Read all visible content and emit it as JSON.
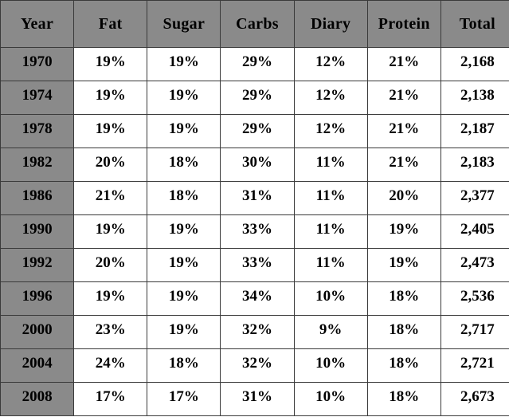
{
  "table": {
    "name": "nutrition-composition-by-year",
    "columns": [
      {
        "key": "year",
        "label": "Year",
        "shaded": true
      },
      {
        "key": "fat",
        "label": "Fat",
        "shaded": false
      },
      {
        "key": "sugar",
        "label": "Sugar",
        "shaded": false
      },
      {
        "key": "carbs",
        "label": "Carbs",
        "shaded": false
      },
      {
        "key": "diary",
        "label": "Diary",
        "shaded": false
      },
      {
        "key": "protein",
        "label": "Protein",
        "shaded": false
      },
      {
        "key": "total",
        "label": "Total",
        "shaded": false
      }
    ],
    "rows": [
      {
        "year": "1970",
        "fat": "19%",
        "sugar": "19%",
        "carbs": "29%",
        "diary": "12%",
        "protein": "21%",
        "total": "2,168"
      },
      {
        "year": "1974",
        "fat": "19%",
        "sugar": "19%",
        "carbs": "29%",
        "diary": "12%",
        "protein": "21%",
        "total": "2,138"
      },
      {
        "year": "1978",
        "fat": "19%",
        "sugar": "19%",
        "carbs": "29%",
        "diary": "12%",
        "protein": "21%",
        "total": "2,187"
      },
      {
        "year": "1982",
        "fat": "20%",
        "sugar": "18%",
        "carbs": "30%",
        "diary": "11%",
        "protein": "21%",
        "total": "2,183"
      },
      {
        "year": "1986",
        "fat": "21%",
        "sugar": "18%",
        "carbs": "31%",
        "diary": "11%",
        "protein": "20%",
        "total": "2,377"
      },
      {
        "year": "1990",
        "fat": "19%",
        "sugar": "19%",
        "carbs": "33%",
        "diary": "11%",
        "protein": "19%",
        "total": "2,405"
      },
      {
        "year": "1992",
        "fat": "20%",
        "sugar": "19%",
        "carbs": "33%",
        "diary": "11%",
        "protein": "19%",
        "total": "2,473"
      },
      {
        "year": "1996",
        "fat": "19%",
        "sugar": "19%",
        "carbs": "34%",
        "diary": "10%",
        "protein": "18%",
        "total": "2,536"
      },
      {
        "year": "2000",
        "fat": "23%",
        "sugar": "19%",
        "carbs": "32%",
        "diary": "9%",
        "protein": "18%",
        "total": "2,717"
      },
      {
        "year": "2004",
        "fat": "24%",
        "sugar": "18%",
        "carbs": "32%",
        "diary": "10%",
        "protein": "18%",
        "total": "2,721"
      },
      {
        "year": "2008",
        "fat": "17%",
        "sugar": "17%",
        "carbs": "31%",
        "diary": "10%",
        "protein": "18%",
        "total": "2,673"
      }
    ]
  },
  "chart_data": {
    "type": "table",
    "title": "",
    "columns": [
      "Year",
      "Fat",
      "Sugar",
      "Carbs",
      "Diary",
      "Protein",
      "Total"
    ],
    "x": [
      "1970",
      "1974",
      "1978",
      "1982",
      "1986",
      "1990",
      "1992",
      "1996",
      "2000",
      "2004",
      "2008"
    ],
    "xlabel": "Year",
    "ylabel": "",
    "series": [
      {
        "name": "Fat",
        "unit": "%",
        "values": [
          19,
          19,
          19,
          20,
          21,
          19,
          20,
          19,
          23,
          24,
          17
        ]
      },
      {
        "name": "Sugar",
        "unit": "%",
        "values": [
          19,
          19,
          19,
          18,
          18,
          19,
          19,
          19,
          19,
          18,
          17
        ]
      },
      {
        "name": "Carbs",
        "unit": "%",
        "values": [
          29,
          29,
          29,
          30,
          31,
          33,
          33,
          34,
          32,
          32,
          31
        ]
      },
      {
        "name": "Diary",
        "unit": "%",
        "values": [
          12,
          12,
          12,
          11,
          11,
          11,
          11,
          10,
          9,
          10,
          10
        ]
      },
      {
        "name": "Protein",
        "unit": "%",
        "values": [
          21,
          21,
          21,
          21,
          20,
          19,
          19,
          18,
          18,
          18,
          18
        ]
      },
      {
        "name": "Total",
        "unit": "calories",
        "values": [
          2168,
          2138,
          2187,
          2183,
          2377,
          2405,
          2473,
          2536,
          2717,
          2721,
          2673
        ]
      }
    ],
    "grid": true,
    "legend": "none"
  },
  "style": {
    "header_background": "#8a8a8a",
    "year_column_background": "#8a8a8a",
    "cell_background": "#ffffff",
    "border_color": "#3a3a3a",
    "text_color": "#000000"
  }
}
